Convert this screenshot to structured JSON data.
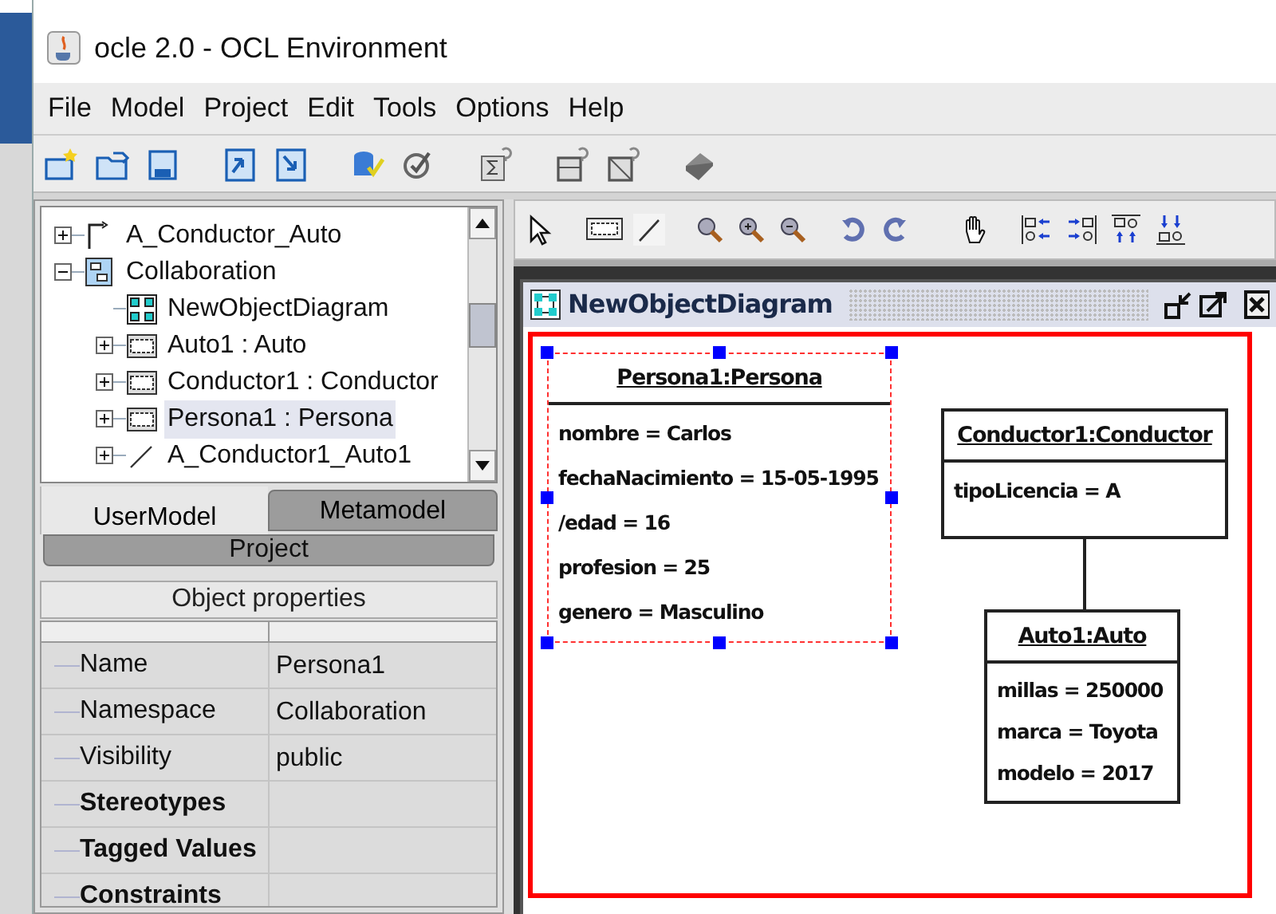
{
  "window": {
    "title": "ocle 2.0 - OCL Environment"
  },
  "menu": [
    "File",
    "Model",
    "Project",
    "Edit",
    "Tools",
    "Options",
    "Help"
  ],
  "tree": {
    "items": [
      {
        "label": "A_Conductor_Auto",
        "kind": "association",
        "expanded": false,
        "selected": false
      },
      {
        "label": "Collaboration",
        "kind": "collaboration",
        "expanded": true,
        "selected": false,
        "children": [
          {
            "label": "NewObjectDiagram",
            "kind": "diagram",
            "selected": false
          },
          {
            "label": "Auto1 : Auto",
            "kind": "object",
            "expanded": false,
            "selected": false
          },
          {
            "label": "Conductor1 : Conductor",
            "kind": "object",
            "expanded": false,
            "selected": false
          },
          {
            "label": "Persona1 : Persona",
            "kind": "object",
            "expanded": false,
            "selected": true
          },
          {
            "label": "A_Conductor1_Auto1",
            "kind": "link",
            "expanded": false,
            "selected": false
          }
        ]
      }
    ]
  },
  "tabs": [
    {
      "label": "UserModel",
      "selected": true
    },
    {
      "label": "Metamodel",
      "selected": false
    }
  ],
  "project_tab": "Project",
  "properties": {
    "title": "Object properties",
    "rows": [
      {
        "name": "Name",
        "value": "Persona1",
        "bold": false
      },
      {
        "name": "Namespace",
        "value": "Collaboration",
        "bold": false
      },
      {
        "name": "Visibility",
        "value": "public",
        "bold": false
      },
      {
        "name": "Stereotypes",
        "bold": true
      },
      {
        "name": "Tagged Values",
        "bold": true
      },
      {
        "name": "Constraints",
        "bold": true
      }
    ]
  },
  "diagram": {
    "title": "NewObjectDiagram",
    "objects": [
      {
        "title": "Persona1:Persona",
        "selected": true,
        "attributes": [
          "nombre = Carlos",
          "fechaNacimiento = 15-05-1995",
          "/edad = 16",
          "profesion = 25",
          "genero = Masculino"
        ]
      },
      {
        "title": "Conductor1:Conductor",
        "selected": false,
        "attributes": [
          "tipoLicencia = A"
        ]
      },
      {
        "title": "Auto1:Auto",
        "selected": false,
        "attributes": [
          "millas = 250000",
          "marca = Toyota",
          "modelo = 2017"
        ]
      }
    ]
  }
}
